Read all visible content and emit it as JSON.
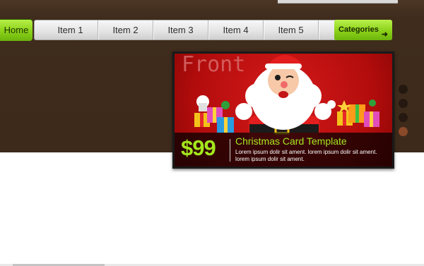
{
  "nav": {
    "home": "Home",
    "items": [
      "Item 1",
      "Item 2",
      "Item 3",
      "Item 4",
      "Item 5"
    ],
    "categories": "Categories",
    "categories_icon": "arrow-icon"
  },
  "slide": {
    "watermark": "Front",
    "price": "$99",
    "title": "Christmas Card Template",
    "description": "Lorem ipsum dolir sit ament. lorem ipsum dolir sit ament. lorem ipsum dolir sit ament."
  },
  "pager": {
    "count": 4,
    "active_index": 3
  },
  "colors": {
    "accent": "#a4e61d",
    "header_bg": "#3d2a1b",
    "slide_bg": "#b20c0c"
  }
}
